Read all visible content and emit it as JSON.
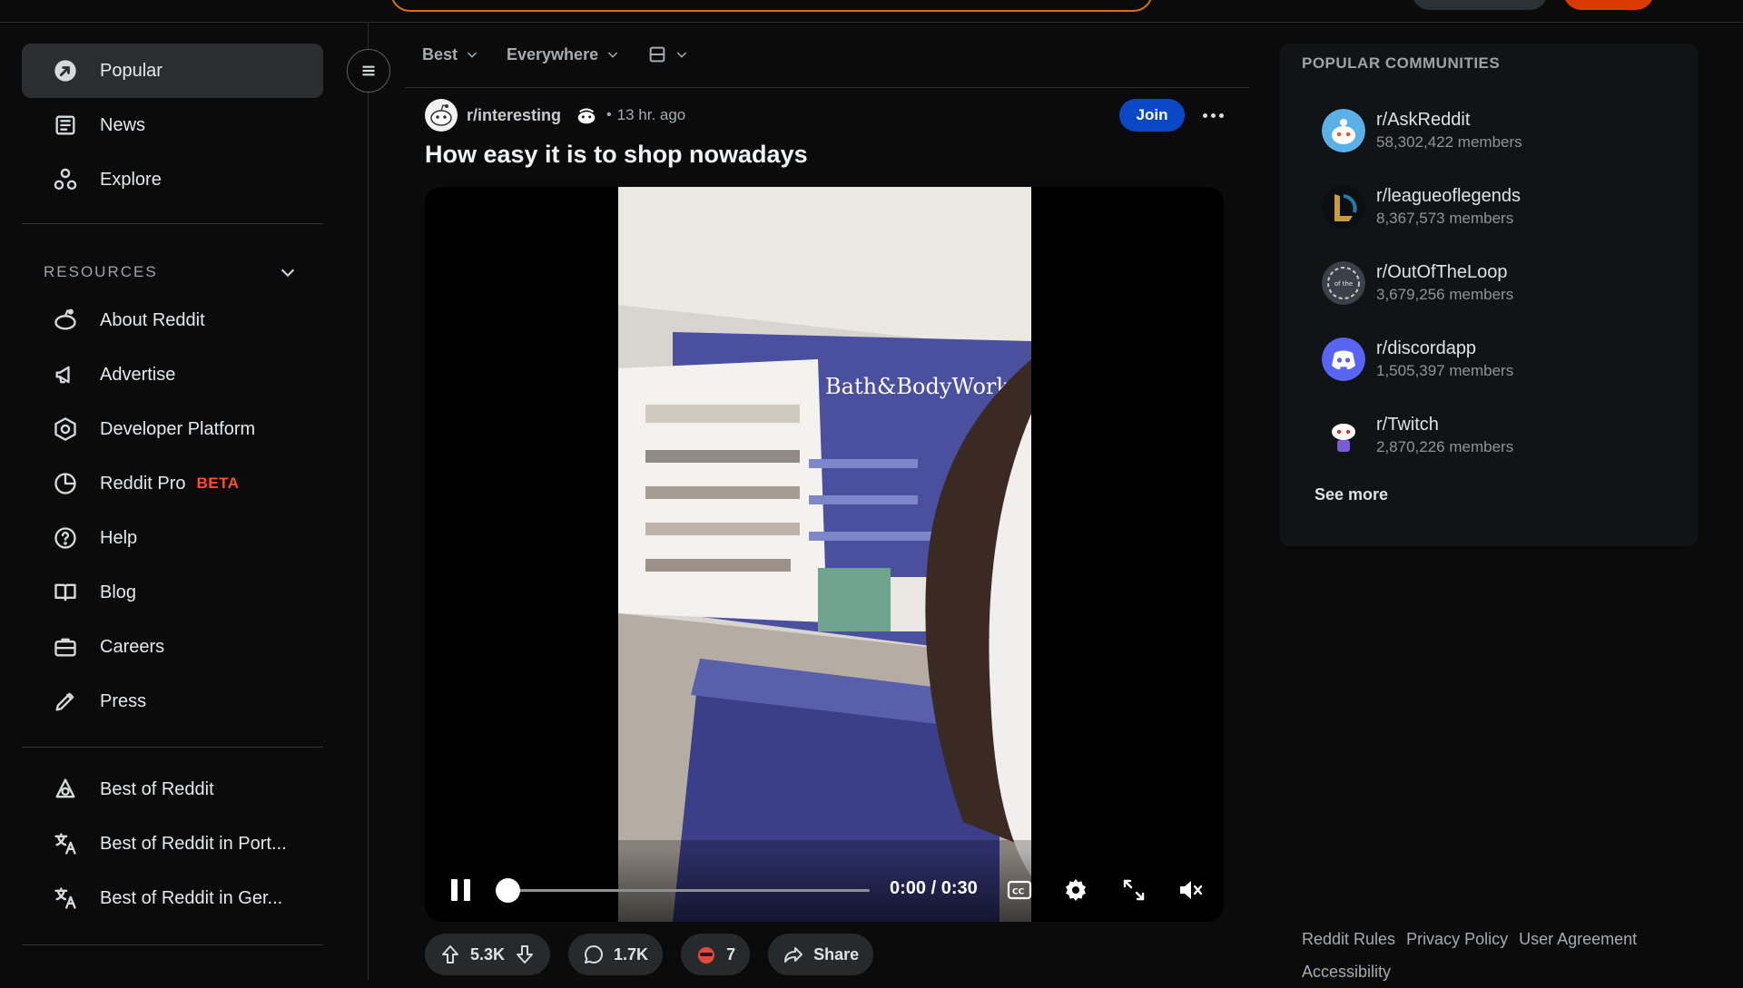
{
  "header": {
    "search_placeholder": ""
  },
  "sidebar": {
    "main": [
      {
        "label": "Popular",
        "icon": "popular-icon",
        "active": true
      },
      {
        "label": "News",
        "icon": "news-icon"
      },
      {
        "label": "Explore",
        "icon": "explore-icon"
      }
    ],
    "resources_title": "RESOURCES",
    "resources": [
      {
        "label": "About Reddit",
        "icon": "snoo-icon"
      },
      {
        "label": "Advertise",
        "icon": "megaphone-icon"
      },
      {
        "label": "Developer Platform",
        "icon": "developer-icon"
      },
      {
        "label": "Reddit Pro",
        "icon": "pro-chart-icon",
        "badge": "BETA"
      },
      {
        "label": "Help",
        "icon": "help-icon"
      },
      {
        "label": "Blog",
        "icon": "blog-icon"
      },
      {
        "label": "Careers",
        "icon": "briefcase-icon"
      },
      {
        "label": "Press",
        "icon": "pen-icon"
      }
    ],
    "best_of": [
      {
        "label": "Best of Reddit",
        "icon": "best-of-icon"
      },
      {
        "label": "Best of Reddit in Port...",
        "icon": "translate-icon"
      },
      {
        "label": "Best of Reddit in Ger...",
        "icon": "translate-icon"
      }
    ]
  },
  "feed": {
    "sort": "Best",
    "location": "Everywhere",
    "view_icon": "card-view-icon"
  },
  "post": {
    "subreddit": "r/interesting",
    "separator": "•",
    "time": "13 hr. ago",
    "join_label": "Join",
    "title": "How easy it is to shop nowadays",
    "video": {
      "time": "0:00 / 0:30",
      "progress": 0,
      "store_sign": "Bath&BodyWorks"
    },
    "votes": "5.3K",
    "comments": "1.7K",
    "awards": "7",
    "share_label": "Share"
  },
  "right": {
    "title": "POPULAR COMMUNITIES",
    "communities": [
      {
        "name": "r/AskReddit",
        "members": "58,302,422 members"
      },
      {
        "name": "r/leagueoflegends",
        "members": "8,367,573 members"
      },
      {
        "name": "r/OutOfTheLoop",
        "members": "3,679,256 members"
      },
      {
        "name": "r/discordapp",
        "members": "1,505,397 members"
      },
      {
        "name": "r/Twitch",
        "members": "2,870,226 members"
      }
    ],
    "see_more": "See more",
    "footer": [
      "Reddit Rules",
      "Privacy Policy",
      "User Agreement",
      "Accessibility"
    ]
  },
  "colors": {
    "accent": "#d93a00",
    "join": "#0a48c5",
    "beta": "#ff4c2b",
    "discord": "#5865f2"
  }
}
